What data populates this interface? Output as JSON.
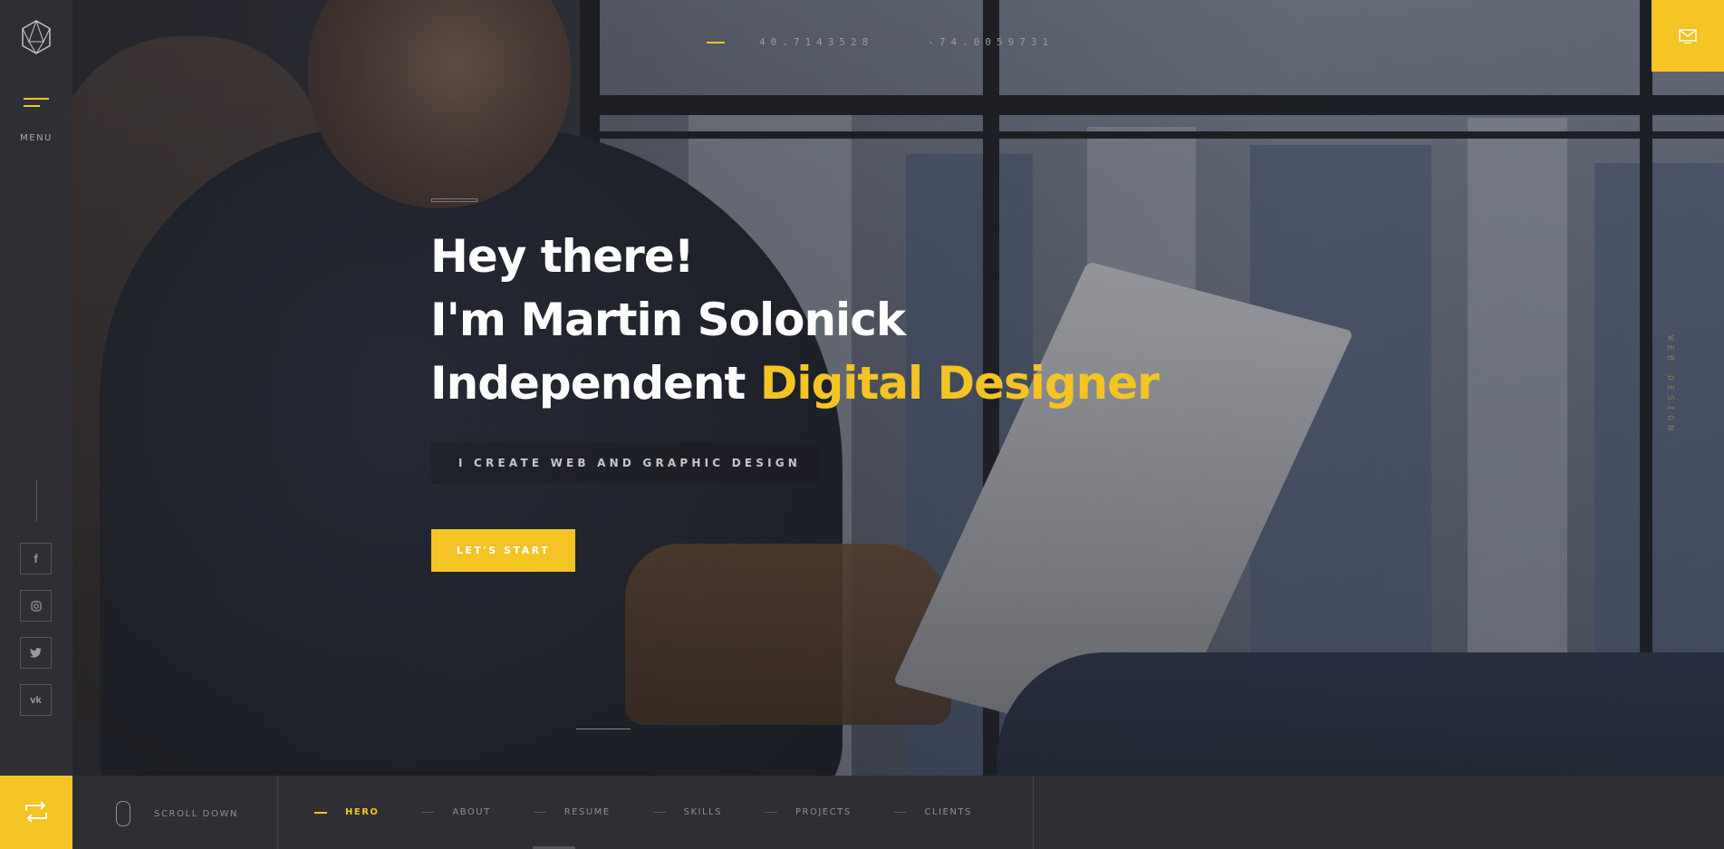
{
  "sidebar": {
    "menu_label": "MENU",
    "social": [
      {
        "name": "facebook-icon",
        "glyph": "f"
      },
      {
        "name": "instagram-icon",
        "glyph": "◎"
      },
      {
        "name": "twitter-icon",
        "glyph": "🐦"
      },
      {
        "name": "vk-icon",
        "glyph": "vk"
      }
    ]
  },
  "coords": {
    "latitude": "40.7143528",
    "longitude": "-74.0059731"
  },
  "side_text": "WEB DESIGN",
  "hero": {
    "line1": "Hey there!",
    "line2": "I'm Martin Solonick",
    "line3_plain": "Independent ",
    "line3_accent": "Digital Designer",
    "subtitle": "I CREATE WEB AND GRAPHIC DESIGN",
    "cta_label": "LET'S START"
  },
  "bottom_bar": {
    "scroll_label": "SCROLL DOWN",
    "nav": [
      {
        "label": "HERO",
        "active": true
      },
      {
        "label": "ABOUT",
        "active": false
      },
      {
        "label": "RESUME",
        "active": false
      },
      {
        "label": "SKILLS",
        "active": false
      },
      {
        "label": "PROJECTS",
        "active": false
      },
      {
        "label": "CLIENTS",
        "active": false
      }
    ]
  },
  "colors": {
    "accent": "#f4c425",
    "sidebar": "#303036",
    "bottom_bar": "#2e2e33"
  }
}
